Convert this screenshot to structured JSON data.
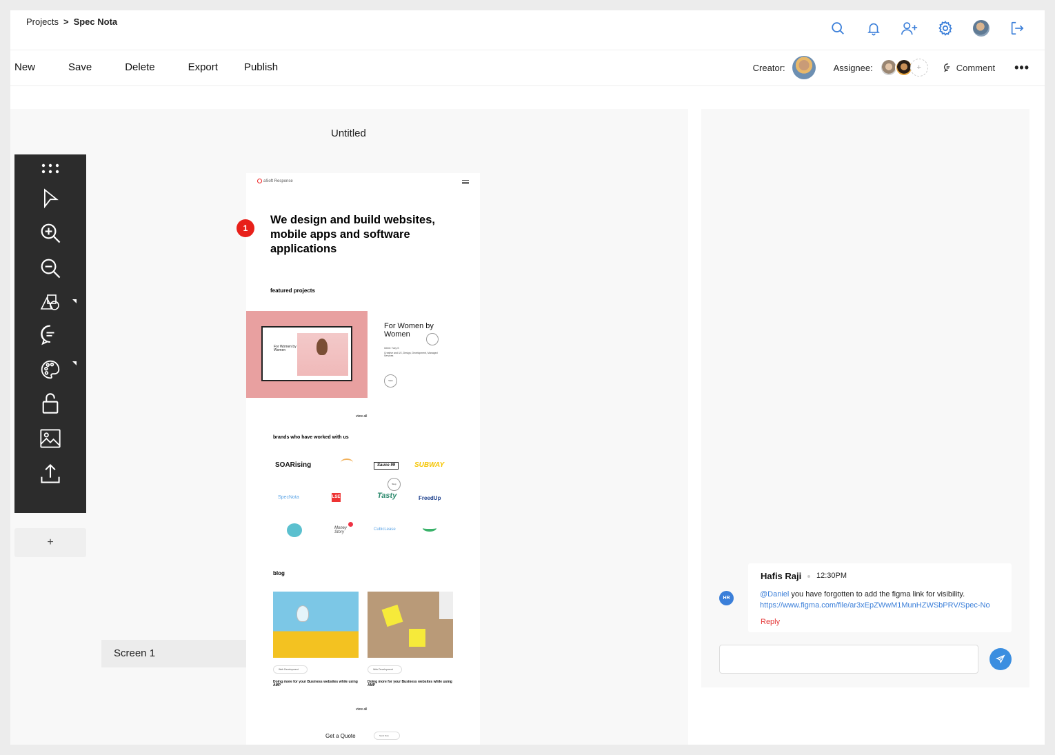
{
  "breadcrumb": {
    "parent": "Projects",
    "separator": ">",
    "current": "Spec Nota"
  },
  "topbar": {
    "icons": [
      "search-icon",
      "bell-icon",
      "add-user-icon",
      "gear-icon",
      "avatar",
      "logout-icon"
    ],
    "accent": "#3b7fd9"
  },
  "toolbar": {
    "menu": [
      "New",
      "Save",
      "Delete",
      "Export",
      "Publish"
    ],
    "creator_label": "Creator:",
    "assignee_label": "Assignee:",
    "add_assignee": "+",
    "comment_label": "Comment",
    "more_label": "•••"
  },
  "canvas": {
    "title": "Untitled",
    "tools": [
      "grid-icon",
      "pointer-icon",
      "zoom-in-icon",
      "zoom-out-icon",
      "shapes-icon",
      "comment-icon",
      "palette-icon",
      "lock-icon",
      "image-icon",
      "upload-icon"
    ],
    "add_label": "+",
    "screen_tab": "Screen 1",
    "pin_number": "1"
  },
  "preview": {
    "logo": "aSoft Response",
    "hero": "We design and build websites, mobile apps and software applications",
    "featured_heading": "featured projects",
    "feature_screen_text": "For Women by Women",
    "feature_title": "For Women by Women",
    "feature_client": "Client: Tuxy S",
    "feature_services": "Creative and UX, Design, Development, Managed Services",
    "feature_btn": "View",
    "view_all": "view all",
    "brands_heading": "brands who have worked with us",
    "brands_row1": [
      "SOARising",
      "",
      "Sauce 99",
      "SUBWAY"
    ],
    "brands_row2": [
      "SpecNota",
      "LSE",
      "Tasty",
      "FreedUp"
    ],
    "brands_row3": [
      "",
      "Money Story",
      "CubicLease",
      ""
    ],
    "brands_stop": "Stop",
    "blog_heading": "blog",
    "blog_tag": "Web Development",
    "blog_title": "Doing more for your Business websites while using AMP",
    "view_all_2": "view all",
    "quote": "Get a Quote",
    "quote_btn": "Send Now"
  },
  "comments": [
    {
      "initials": "HR",
      "author": "Hafis Raji",
      "time": "12:30PM",
      "mention": "@Daniel",
      "text": " you have forgotten to add the figma link for visibility.",
      "link": "https://www.figma.com/file/ar3xEpZWwM1MunHZWSbPRV/Spec-No",
      "reply_label": "Reply"
    }
  ],
  "composer": {
    "send_icon": "send-icon",
    "placeholder": ""
  }
}
